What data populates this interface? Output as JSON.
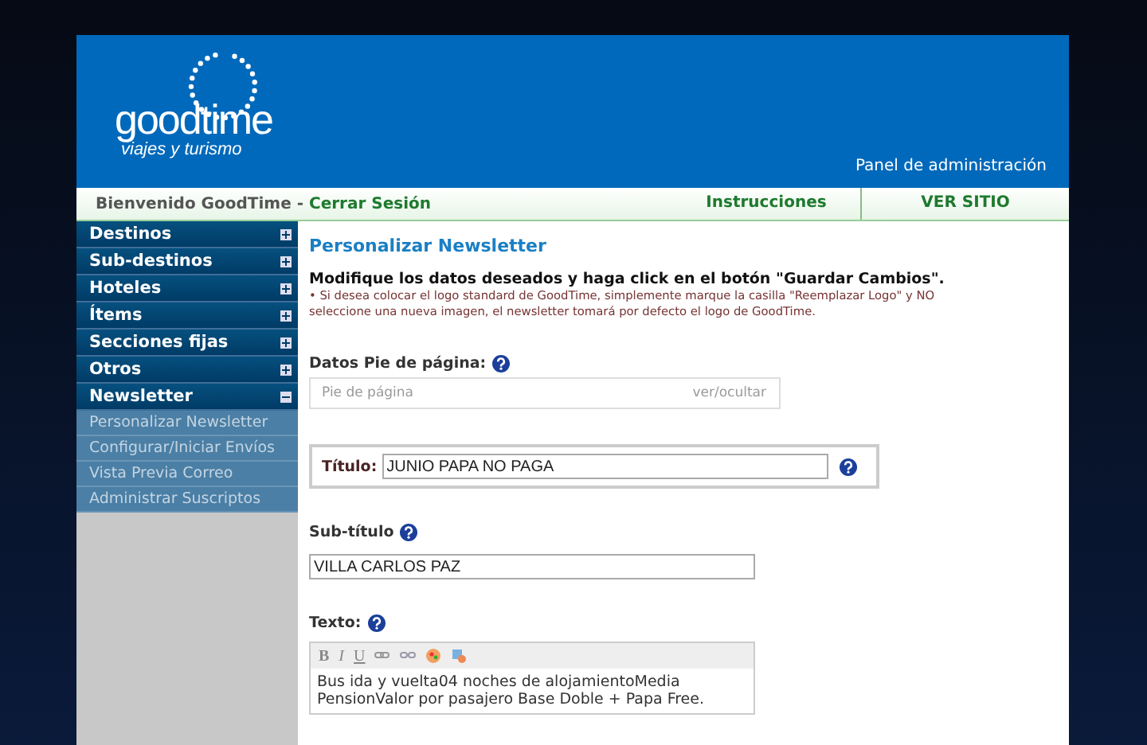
{
  "header": {
    "logo": {
      "name": "goodtime",
      "tagline": "viajes y turismo"
    },
    "panel_label": "Panel de administración"
  },
  "navbar": {
    "welcome": "Bienvenido GoodTime",
    "separator": "-",
    "logout": "Cerrar Sesión",
    "links": [
      "Instrucciones",
      "VER SITIO"
    ]
  },
  "sidebar": {
    "items": [
      {
        "label": "Destinos",
        "expanded": false
      },
      {
        "label": "Sub-destinos",
        "expanded": false
      },
      {
        "label": "Hoteles",
        "expanded": false
      },
      {
        "label": "Ítems",
        "expanded": false
      },
      {
        "label": "Secciones fijas",
        "expanded": false
      },
      {
        "label": "Otros",
        "expanded": false
      },
      {
        "label": "Newsletter",
        "expanded": true,
        "children": [
          {
            "label": "Personalizar Newsletter"
          },
          {
            "label": "Configurar/Iniciar Envíos"
          },
          {
            "label": "Vista Previa Correo"
          },
          {
            "label": "Administrar Suscriptos"
          }
        ]
      }
    ]
  },
  "content": {
    "title": "Personalizar Newsletter",
    "instructions": "Modifique los datos deseados y haga click en el botón \"Guardar Cambios\".",
    "note": "• Si desea colocar el logo standard de GoodTime, simplemente marque la casilla \"Reemplazar Logo\" y NO seleccione una nueva imagen, el newsletter tomará por defecto el logo de GoodTime.",
    "footer_field": {
      "label": "Datos Pie de página:",
      "placeholder": "Pie de página",
      "toggle": "ver/ocultar"
    },
    "title_field": {
      "label": "Título:",
      "value": "JUNIO PAPA NO PAGA"
    },
    "subtitle_field": {
      "label": "Sub-título",
      "value": "VILLA CARLOS PAZ"
    },
    "text_field": {
      "label": "Texto:",
      "toolbar": [
        "B",
        "I",
        "U"
      ],
      "value": "Bus ida y vuelta04 noches de alojamientoMedia PensionValor por pasajero Base Doble + Papa Free."
    }
  }
}
